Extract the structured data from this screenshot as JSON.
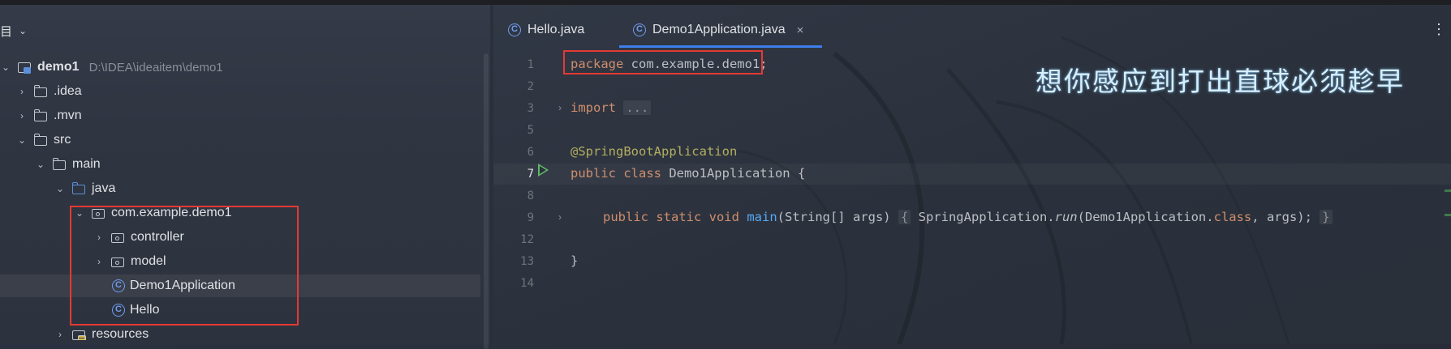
{
  "project_panel": {
    "header_label": "项目",
    "tree": [
      {
        "label": "demo1",
        "path": "D:\\IDEA\\ideaitem\\demo1",
        "type": "module",
        "expanded": true
      },
      {
        "label": ".idea",
        "type": "folder",
        "expanded": false
      },
      {
        "label": ".mvn",
        "type": "folder",
        "expanded": false
      },
      {
        "label": "src",
        "type": "folder",
        "expanded": true
      },
      {
        "label": "main",
        "type": "folder",
        "expanded": true
      },
      {
        "label": "java",
        "type": "source-folder",
        "expanded": true
      },
      {
        "label": "com.example.demo1",
        "type": "package",
        "expanded": true
      },
      {
        "label": "controller",
        "type": "package",
        "expanded": false
      },
      {
        "label": "model",
        "type": "package",
        "expanded": false
      },
      {
        "label": "Demo1Application",
        "type": "spring-class",
        "selected": true
      },
      {
        "label": "Hello",
        "type": "class"
      },
      {
        "label": "resources",
        "type": "resources-folder",
        "expanded": false
      }
    ]
  },
  "editor": {
    "tabs": [
      {
        "label": "Hello.java",
        "active": false
      },
      {
        "label": "Demo1Application.java",
        "active": true,
        "close_icon": "×"
      }
    ],
    "more_icon": "⋮",
    "line_numbers": [
      "1",
      "2",
      "3",
      "5",
      "6",
      "7",
      "8",
      "9",
      "12",
      "13",
      "14"
    ],
    "code": {
      "l1_kw": "package",
      "l1_rest": " com.example.demo1;",
      "l3_kw": "import",
      "l3_fold": "...",
      "l6_ann": "@SpringBootApplication",
      "l7_kw": "public class",
      "l7_rest": " Demo1Application {",
      "l9_kw": "public static void",
      "l9_fn": "main",
      "l9_params": "(String[] args) ",
      "l9_fold_open": "{",
      "l9_body_a": " SpringApplication.",
      "l9_body_run": "run",
      "l9_body_b": "(Demo1Application.",
      "l9_body_class": "class",
      "l9_body_c": ", args); ",
      "l9_fold_close": "}",
      "l13": "}"
    },
    "overlay_caption": "想你感应到打出直球必须趁早"
  },
  "colors": {
    "keyword": "#cf8e6d",
    "annotation": "#b3ae60",
    "function": "#56a8f5",
    "highlight_box": "#e53935",
    "active_tab_underline": "#3d7eea",
    "run_icon": "#5fb865"
  }
}
